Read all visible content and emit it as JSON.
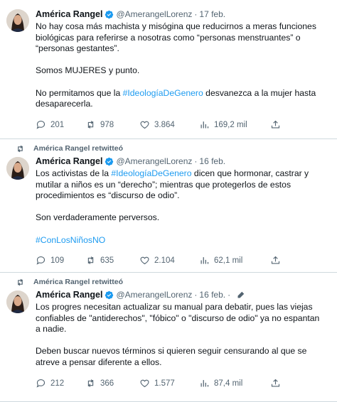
{
  "tweets": [
    {
      "retweet_label": "",
      "name": "América Rangel",
      "handle": "@AmerangelLorenz",
      "separator": "·",
      "time": "17 feb.",
      "lines": [
        "No hay cosa más machista y misógina que reducirnos a meras funciones",
        "biológicas para referirse a nosotras como “personas menstruantes” o",
        "“personas gestantes”.",
        "",
        "Somos MUJERES y punto.",
        "",
        "No permitamos que la ",
        "desaparecerla."
      ],
      "hashtag": "#IdeologíaDeGenero",
      "line7_rest": " desvanezca a la mujer hasta",
      "replies": "201",
      "retweets": "978",
      "likes": "3.864",
      "views": "169,2 mil"
    },
    {
      "retweet_label": "América Rangel retwitteó",
      "name": "América Rangel",
      "handle": "@AmerangelLorenz",
      "separator": "·",
      "time": "16 feb.",
      "line1_pre": "Los activistas de la ",
      "hashtag": "#IdeologíaDeGenero",
      "line1_post": " dicen que hormonar, castrar y",
      "line2": "mutilar a niños es un “derecho”; mientras que protegerlos de estos",
      "line3": "procedimientos es “discurso de odio”.",
      "line4": "Son verdaderamente perversos.",
      "hashtag2": "#ConLosNiñosNO",
      "replies": "109",
      "retweets": "635",
      "likes": "2.104",
      "views": "62,1 mil"
    },
    {
      "retweet_label": "América Rangel retwitteó",
      "name": "América Rangel",
      "handle": "@AmerangelLorenz",
      "separator": "·",
      "time": "16 feb.",
      "line1": "Los progres necesitan actualizar su manual para debatir, pues las viejas",
      "line2": "confiables de \"antiderechos\", \"fóbico\" o \"discurso de odio\" ya no espantan",
      "line3": "a nadie.",
      "line4": "Deben buscar nuevos términos si quieren seguir censurando al que se",
      "line5": "atreve a pensar diferente a ellos.",
      "replies": "212",
      "retweets": "366",
      "likes": "1.577",
      "views": "87,4 mil"
    }
  ],
  "colors": {
    "link": "#1d9bf0",
    "muted": "#536471",
    "text": "#0f1419",
    "divider": "#cfd9de"
  },
  "icons": [
    "retweet-icon",
    "verified-badge-icon",
    "reply-icon",
    "like-icon",
    "views-icon",
    "share-icon",
    "edit-icon"
  ]
}
